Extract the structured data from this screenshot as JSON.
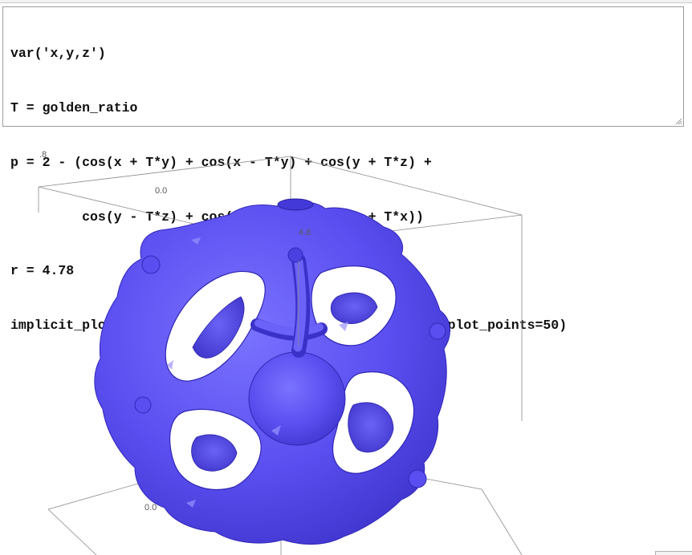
{
  "cell": {
    "lines": [
      "var('x,y,z')",
      "T = golden_ratio",
      "p = 2 - (cos(x + T*y) + cos(x - T*y) + cos(y + T*z) +",
      "         cos(y - T*z) + cos(z - T*x) + cos(z + T*x))",
      "r = 4.78",
      "implicit_plot3d(p, (x, -r, r), (y, -r, r), (z, -r, r), plot_points=50)"
    ]
  },
  "plot": {
    "surface_color": "#5a4ef0",
    "axis_labels": {
      "top_left_corner": ".8",
      "upper_origin": "0.0",
      "center": "4.8",
      "lower_origin": "0.0"
    },
    "icons": [
      "resize-grip-icon"
    ]
  }
}
